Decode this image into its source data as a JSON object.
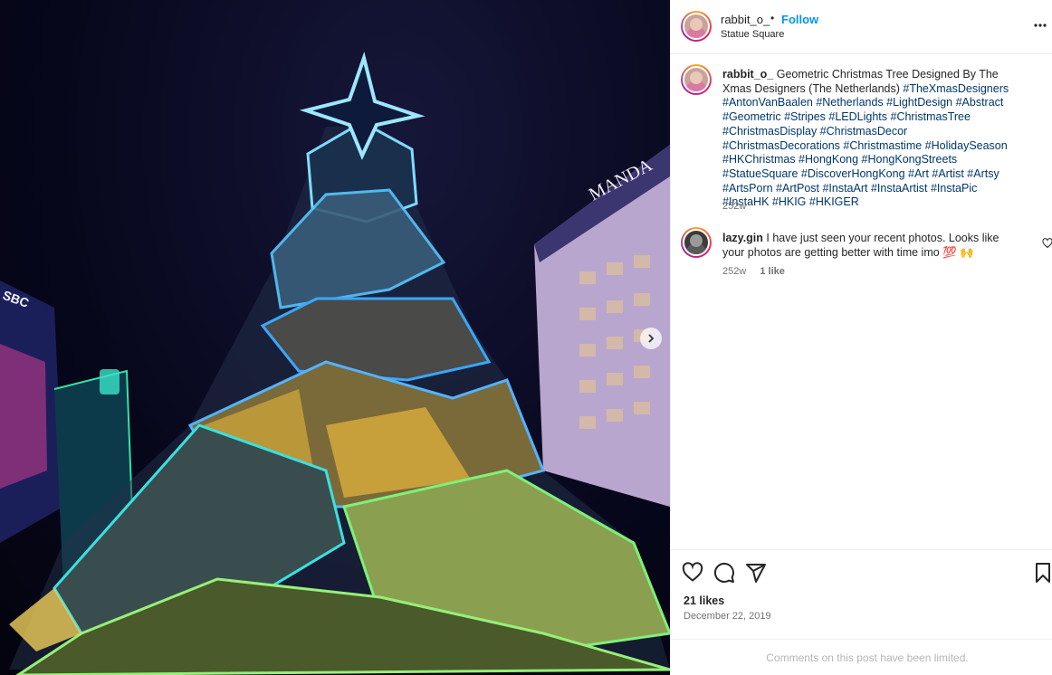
{
  "post": {
    "username": "rabbit_o_",
    "separator": "•",
    "follow_label": "Follow",
    "location": "Statue Square"
  },
  "caption": {
    "username": "rabbit_o_",
    "text": " Geometric Christmas Tree Designed By The Xmas Designers (The Netherlands) ",
    "hashtags": "#TheXmasDesigners #AntonVanBaalen #Netherlands #LightDesign #Abstract #Geometric #Stripes #LEDLights #ChristmasTree #ChristmasDisplay #ChristmasDecor #ChristmasDecorations #Christmastime #HolidaySeason #HKChristmas #HongKong #HongKongStreets #StatueSquare #DiscoverHongKong #Art #Artist #Artsy #ArtsPorn #ArtPost #InstaArt #InstaArtist #InstaPic #InstaHK #HKIG #HKIGER",
    "age": "252w"
  },
  "comment": {
    "username": "lazy.gin",
    "text": " I have just seen your recent photos. Looks like your photos are getting better with time imo 💯 🙌",
    "age": "252w",
    "likes": "1 like"
  },
  "footer": {
    "like_count": "21 likes",
    "date": "December 22, 2019",
    "limited_notice": "Comments on this post have been limited."
  },
  "photo": {
    "building_sign": "MANDA",
    "left_sign": "SBC"
  },
  "icons": {
    "more": "more-options-icon",
    "like": "heart-icon",
    "comment": "comment-icon",
    "share": "share-icon",
    "save": "bookmark-icon",
    "next": "chevron-right-icon"
  },
  "colors": {
    "accent": "#0095f6",
    "hashtag": "#00376b",
    "secondary_text": "#737373"
  }
}
